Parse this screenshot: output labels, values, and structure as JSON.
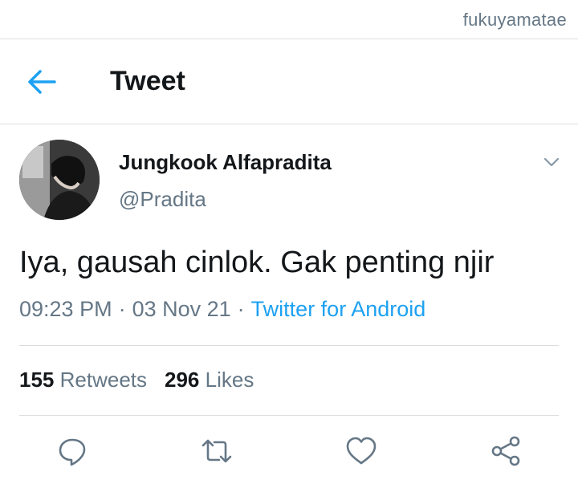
{
  "watermark": "fukuyamatae",
  "header": {
    "title": "Tweet",
    "back_icon": "arrow-left-icon"
  },
  "tweet": {
    "author": {
      "name": "Jungkook Alfapradita",
      "handle": "@Pradita"
    },
    "menu_icon": "chevron-down-icon",
    "text": "Iya, gausah cinlok. Gak penting njir",
    "time": "09:23 PM",
    "date": "03 Nov 21",
    "separator": "·",
    "source": "Twitter for Android",
    "stats": {
      "retweets_count": "155",
      "retweets_label": "Retweets",
      "likes_count": "296",
      "likes_label": "Likes"
    }
  },
  "actions": [
    {
      "icon": "reply-icon"
    },
    {
      "icon": "retweet-icon"
    },
    {
      "icon": "heart-icon"
    },
    {
      "icon": "share-icon"
    }
  ],
  "colors": {
    "accent": "#1da1f2",
    "text_primary": "#14171a",
    "text_secondary": "#657786",
    "divider": "#d9dde0"
  }
}
